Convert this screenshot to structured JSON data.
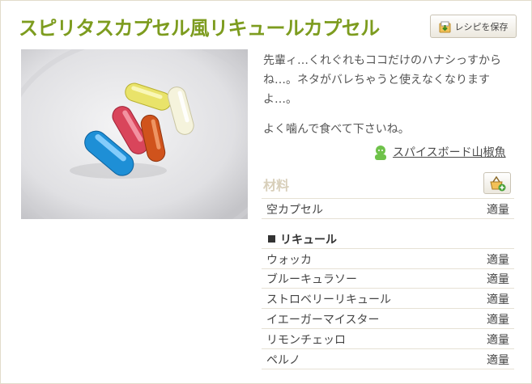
{
  "recipe": {
    "title": "スピリタスカプセル風リキュールカプセル",
    "save_button_label": "レシピを保存",
    "description": "先輩ィ…くれぐれもココだけのハナシっすからね…。ネタがバレちゃうと使えなくなりますよ…。",
    "description_2": "よく噛んで食べて下さいね。",
    "author_name": "スパイスボード山椒魚"
  },
  "ingredients": {
    "heading": "材料",
    "top_items": [
      {
        "name": "空カプセル",
        "qty": "適量"
      }
    ],
    "section_label": "リキュール",
    "section_items": [
      {
        "name": "ウォッカ",
        "qty": "適量"
      },
      {
        "name": "ブルーキュラソー",
        "qty": "適量"
      },
      {
        "name": "ストロベリーリキュール",
        "qty": "適量"
      },
      {
        "name": "イエーガーマイスター",
        "qty": "適量"
      },
      {
        "name": "リモンチェッロ",
        "qty": "適量"
      },
      {
        "name": "ペルノ",
        "qty": "適量"
      }
    ]
  },
  "colors": {
    "title": "#7d9c1f",
    "capsule_blue": "#1e8fd6",
    "capsule_red": "#d9455b",
    "capsule_yellow": "#e6e067",
    "capsule_orange": "#d0531c",
    "capsule_clear": "#f2f0d8"
  },
  "icons": {
    "save_button": "recipe-save-icon",
    "author": "user-avatar-icon",
    "add_to_list": "shopping-basket-add-icon"
  }
}
